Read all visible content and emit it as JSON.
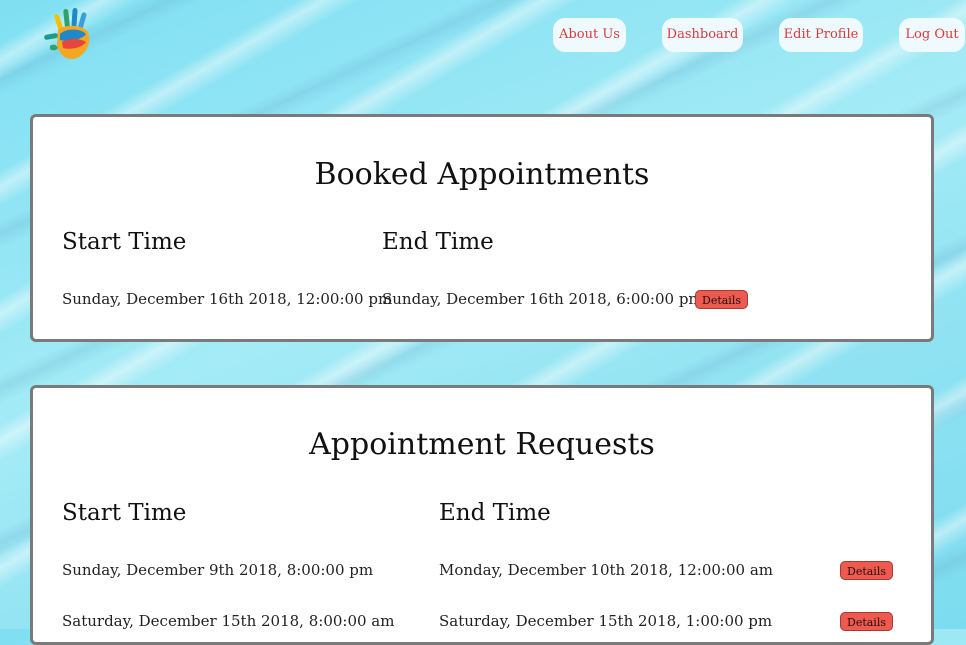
{
  "nav": {
    "about": "About Us",
    "dashboard": "Dashboard",
    "edit_profile": "Edit Profile",
    "logout": "Log Out"
  },
  "booked": {
    "title": "Booked Appointments",
    "start_header": "Start Time",
    "end_header": "End Time",
    "rows": [
      {
        "start": "Sunday, December 16th 2018, 12:00:00 pm",
        "end": "Sunday, December 16th 2018, 6:00:00 pm",
        "action": "Details"
      }
    ]
  },
  "requests": {
    "title": "Appointment Requests",
    "start_header": "Start Time",
    "end_header": "End Time",
    "rows": [
      {
        "start": "Sunday, December 9th 2018, 8:00:00 pm",
        "end": "Monday, December 10th 2018, 12:00:00 am",
        "action": "Details"
      },
      {
        "start": "Saturday, December 15th 2018, 8:00:00 am",
        "end": "Saturday, December 15th 2018, 1:00:00 pm",
        "action": "Details"
      }
    ]
  },
  "colors": {
    "accent": "#d83a3a",
    "details_button": "#ec5a50",
    "card_border": "#7a7a7a"
  },
  "icons": {
    "logo": "handprint-logo-icon"
  }
}
